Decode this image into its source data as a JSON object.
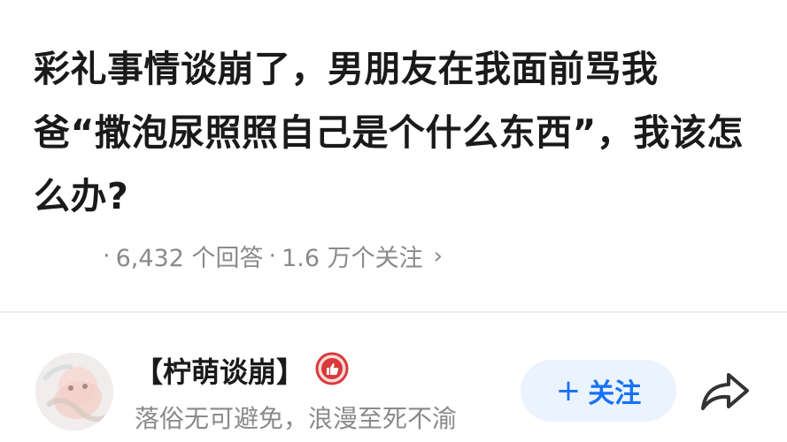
{
  "question": {
    "title": "彩礼事情谈崩了，男朋友在我面前骂我爸“撒泡尿照照自己是个什么东西”，我该怎么办?",
    "answers": "6,432 个回答",
    "followers": "1.6 万个关注",
    "separator": "·",
    "more_chevron": "›"
  },
  "author": {
    "name": "【柠萌谈崩】",
    "bio": "落俗无可避免，浪漫至死不渝",
    "avatar_icon": "avatar-illustration",
    "badge_icon": "thumbs-up-badge-icon",
    "badge_color": "#d8393a"
  },
  "actions": {
    "follow_plus": "+",
    "follow_label": "关注",
    "follow_color": "#1772f6",
    "follow_bg": "#ebf3ff",
    "share_icon": "share-icon"
  }
}
